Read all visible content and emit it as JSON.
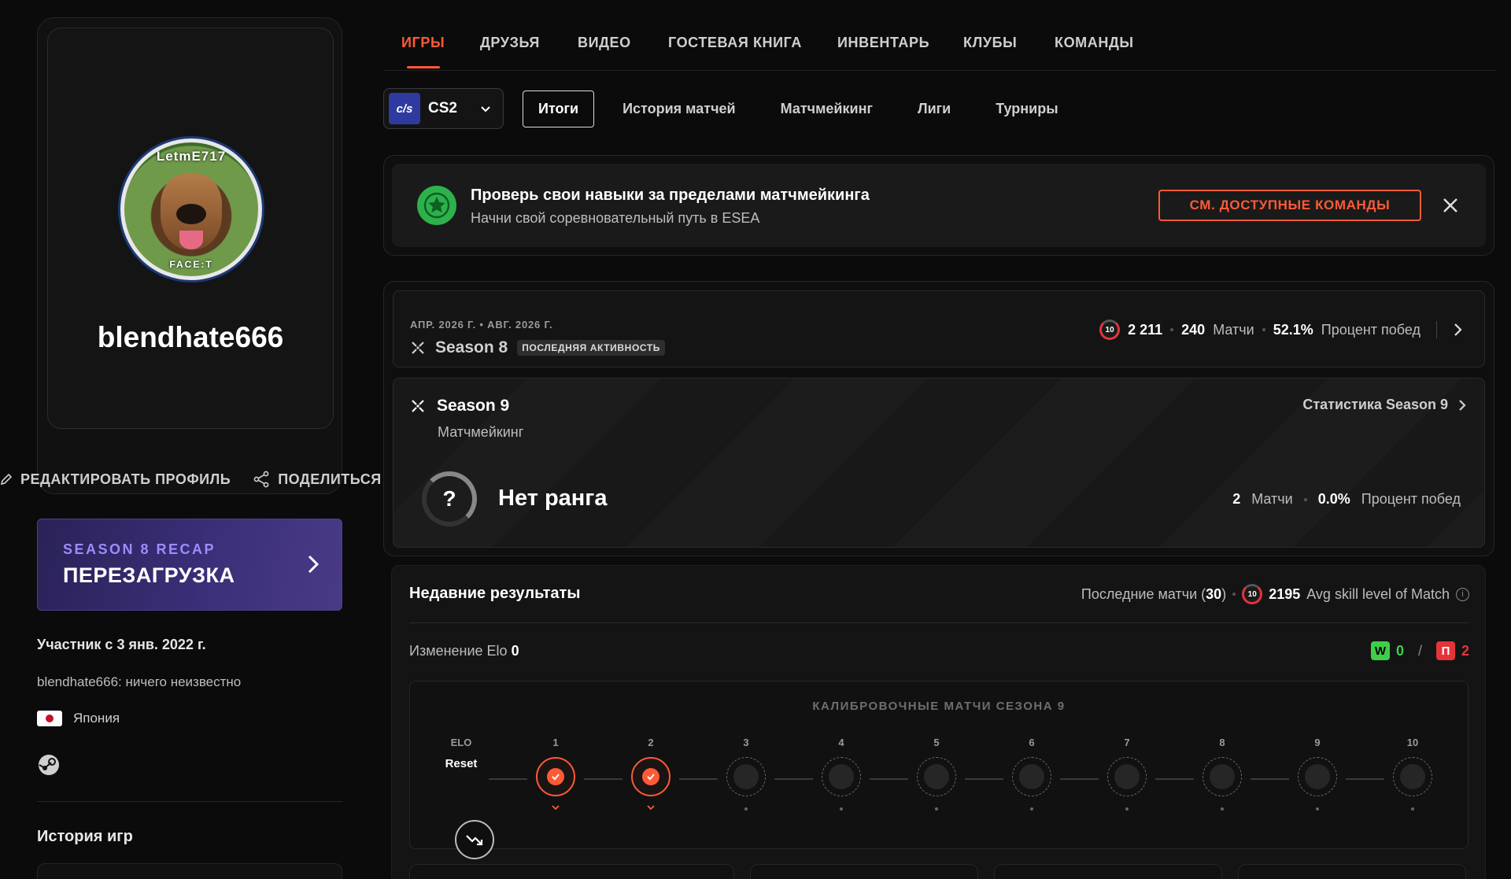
{
  "profile": {
    "avatar_text_top": "LetmE717",
    "avatar_text_bottom": "FACE:T",
    "username": "blendhate666",
    "edit_label": "РЕДАКТИРОВАТЬ ПРОФИЛЬ",
    "share_label": "ПОДЕЛИТЬСЯ",
    "member_since": "Участник с 3 янв. 2022 г.",
    "bio": "blendhate666: ничего неизвестно",
    "country": "Япония",
    "games_history_title": "История игр"
  },
  "recap": {
    "small": "SEASON 8 RECAP",
    "big": "ПЕРЕЗАГРУЗКА"
  },
  "nav": {
    "tabs": [
      {
        "label": "ИГРЫ",
        "active": true
      },
      {
        "label": "ДРУЗЬЯ"
      },
      {
        "label": "ВИДЕО"
      },
      {
        "label": "ГОСТЕВАЯ КНИГА"
      },
      {
        "label": "ИНВЕНТАРЬ"
      },
      {
        "label": "КЛУБЫ"
      },
      {
        "label": "КОМАНДЫ"
      }
    ]
  },
  "game": {
    "logo_text": "c/s",
    "name": "CS2"
  },
  "subtabs": [
    "Итоги",
    "История матчей",
    "Матчмейкинг",
    "Лиги",
    "Турниры"
  ],
  "banner": {
    "title": "Проверь свои навыки за пределами матчмейкинга",
    "subtitle": "Начни свой соревновательный путь в ESEA",
    "cta": "СМ. ДОСТУПНЫЕ КОМАНДЫ"
  },
  "season8": {
    "dates": "АПР. 2026 Г. • АВГ. 2026 Г.",
    "name": "Season 8",
    "badge": "ПОСЛЕДНЯЯ АКТИВНОСТЬ",
    "level": "10",
    "elo": "2 211",
    "matches": "240",
    "matches_label": "Матчи",
    "winrate": "52.1%",
    "winrate_label": "Процент побед"
  },
  "season9": {
    "name": "Season 9",
    "mode": "Матчмейкинг",
    "stats_link": "Статистика Season 9",
    "rank_symbol": "?",
    "rank_label": "Нет ранга",
    "matches": "2",
    "matches_label": "Матчи",
    "winrate": "0.0%",
    "winrate_label": "Процент побед"
  },
  "recent": {
    "title": "Недавние результаты",
    "last_matches_label": "Последние матчи (",
    "last_matches_count": "30",
    "last_matches_close": ")",
    "level": "10",
    "avg_skill": "2195",
    "avg_skill_label": "Avg skill level of Match",
    "elo_change_label": "Изменение Elo",
    "elo_change_value": "0",
    "win_letter": "W",
    "wins": "0",
    "slash": "/",
    "loss_letter": "П",
    "losses": "2"
  },
  "calibration": {
    "title": "КАЛИБРОВОЧНЫЕ МАТЧИ СЕЗОНА 9",
    "elo_label": "ELO",
    "reset_label": "Reset",
    "steps": [
      {
        "label": "1",
        "status": "done"
      },
      {
        "label": "2",
        "status": "done"
      },
      {
        "label": "3",
        "status": "pending"
      },
      {
        "label": "4",
        "status": "pending"
      },
      {
        "label": "5",
        "status": "pending"
      },
      {
        "label": "6",
        "status": "pending"
      },
      {
        "label": "7",
        "status": "pending"
      },
      {
        "label": "8",
        "status": "pending"
      },
      {
        "label": "9",
        "status": "pending"
      },
      {
        "label": "10",
        "status": "pending"
      }
    ]
  },
  "colors": {
    "accent": "#ff5a36",
    "win": "#3fce4a",
    "loss": "#e3343a",
    "recap_purple": "#9c8cff"
  },
  "icons": [
    "pencil-icon",
    "share-icon",
    "chevron-right-icon",
    "chevron-down-icon",
    "star-icon",
    "close-icon",
    "season-icon",
    "info-icon",
    "check-icon",
    "elo-trend-icon",
    "steam-icon"
  ]
}
